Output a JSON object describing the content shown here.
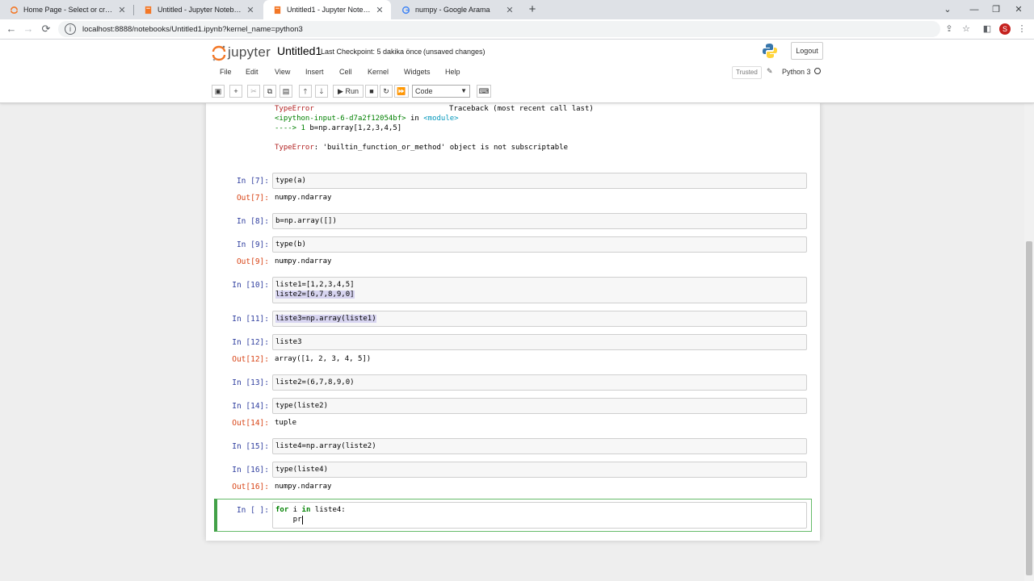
{
  "browser": {
    "tabs": [
      {
        "title": "Home Page - Select or create a notebook",
        "icon": "jupyter-tab-icon"
      },
      {
        "title": "Untitled - Jupyter Notebook",
        "icon": "notebook-tab-icon"
      },
      {
        "title": "Untitled1 - Jupyter Notebook",
        "icon": "notebook-tab-icon"
      },
      {
        "title": "numpy - Google Arama",
        "icon": "google-icon"
      }
    ],
    "url": "localhost:8888/notebooks/Untitled1.ipynb?kernel_name=python3",
    "profile_initial": "S"
  },
  "header": {
    "logo_text": "jupyter",
    "notebook_name": "Untitled1",
    "checkpoint": "Last Checkpoint: 5 dakika önce",
    "unsaved": "(unsaved changes)",
    "logout": "Logout"
  },
  "menu": {
    "items": [
      "File",
      "Edit",
      "View",
      "Insert",
      "Cell",
      "Kernel",
      "Widgets",
      "Help"
    ],
    "trusted": "Trusted",
    "kernel": "Python 3"
  },
  "toolbar": {
    "run_label": "Run",
    "cell_type": "Code"
  },
  "error_output": {
    "line1_a": "TypeError",
    "line1_b": "Traceback (most recent call last)",
    "line2_a": "<ipython-input-6-d7a2f12054bf>",
    "line2_b": " in ",
    "line2_c": "<module>",
    "line3_a": "----> 1",
    "line3_b": " b=np.array[1,2,3,4,5]",
    "line4_a": "TypeError",
    "line4_b": ": 'builtin_function_or_method' object is not subscriptable"
  },
  "cells": {
    "c7_in": "In [7]:",
    "c7_code": "type(a)",
    "c7_out_p": "Out[7]:",
    "c7_out": "numpy.ndarray",
    "c8_in": "In [8]:",
    "c8_code": "b=np.array([])",
    "c9_in": "In [9]:",
    "c9_code": "type(b)",
    "c9_out_p": "Out[9]:",
    "c9_out": "numpy.ndarray",
    "c10_in": "In [10]:",
    "c10_line1": "liste1=[1,2,3,4,5]",
    "c10_line2": "liste2=[6,7,8,9,0]",
    "c11_in": "In [11]:",
    "c11_code": "liste3=np.array(liste1)",
    "c12_in": "In [12]:",
    "c12_code": "liste3",
    "c12_out_p": "Out[12]:",
    "c12_out": "array([1, 2, 3, 4, 5])",
    "c13_in": "In [13]:",
    "c13_code": "liste2=(6,7,8,9,0)",
    "c14_in": "In [14]:",
    "c14_code": "type(liste2)",
    "c14_out_p": "Out[14]:",
    "c14_out": "tuple",
    "c15_in": "In [15]:",
    "c15_code": "liste4=np.array(liste2)",
    "c16_in": "In [16]:",
    "c16_code": "type(liste4)",
    "c16_out_p": "Out[16]:",
    "c16_out": "numpy.ndarray",
    "c17_in": "In [ ]:",
    "c17_kw1": "for",
    "c17_var": " i ",
    "c17_kw2": "in",
    "c17_rest": " liste4:",
    "c17_line2": "    pr"
  }
}
